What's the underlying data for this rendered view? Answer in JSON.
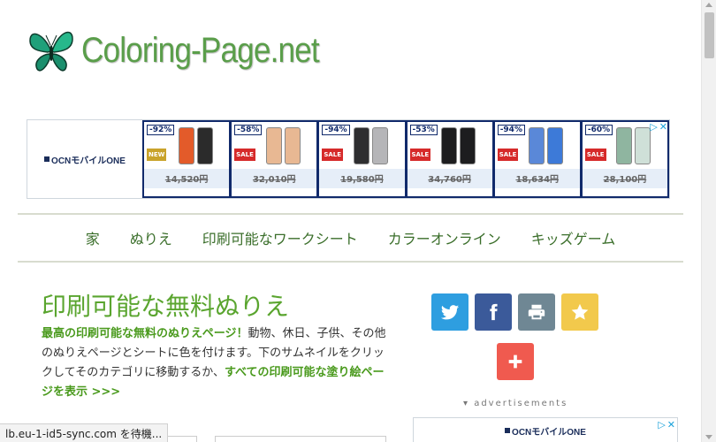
{
  "site": {
    "logo_text": "Coloring-Page.net"
  },
  "ad_top": {
    "brand_text": "OCNモバイルONE",
    "products": [
      {
        "discount": "-92%",
        "tag": "NEW",
        "price": "14,520円",
        "phones": [
          "#e35b2a",
          "#2b2b2b"
        ]
      },
      {
        "discount": "-58%",
        "tag": "SALE",
        "price": "32,010円",
        "phones": [
          "#e8b893",
          "#e8b893"
        ]
      },
      {
        "discount": "-94%",
        "tag": "SALE",
        "price": "19,580円",
        "phones": [
          "#2e2e30",
          "#b5b5b8"
        ]
      },
      {
        "discount": "-53%",
        "tag": "SALE",
        "price": "34,760円",
        "phones": [
          "#1d1d1f",
          "#1d1d1f"
        ]
      },
      {
        "discount": "-94%",
        "tag": "SALE",
        "price": "18,634円",
        "phones": [
          "#5a88d8",
          "#3d7ad8"
        ]
      },
      {
        "discount": "-60%",
        "tag": "SALE",
        "price": "28,100円",
        "phones": [
          "#8fb5a0",
          "#cfe0d8"
        ]
      }
    ]
  },
  "nav": {
    "items": [
      "家",
      "ぬりえ",
      "印刷可能なワークシート",
      "カラーオンライン",
      "キッズゲーム"
    ]
  },
  "main": {
    "title": "印刷可能な無料ぬりえ",
    "intro_highlight": "最高の印刷可能な無料のぬりえページ！",
    "intro_text": "動物、休日、子供、その他のぬりえページとシートに色を付けます。下のサムネイルをクリックしてそのカテゴリに移動するか、",
    "intro_link": "すべての印刷可能な塗り絵ページを表示 >>>"
  },
  "share": {
    "colors": {
      "twitter": "#2e9ee0",
      "facebook": "#3b5a9a",
      "print": "#6f8794",
      "favorite": "#f2c94c",
      "more": "#f05a4f"
    }
  },
  "ads_label": "advertisements",
  "ad_bottom": {
    "brand_text": "OCNモバイルONE"
  },
  "status_bar": {
    "text": "lb.eu-1-id5-sync.com を待機..."
  }
}
